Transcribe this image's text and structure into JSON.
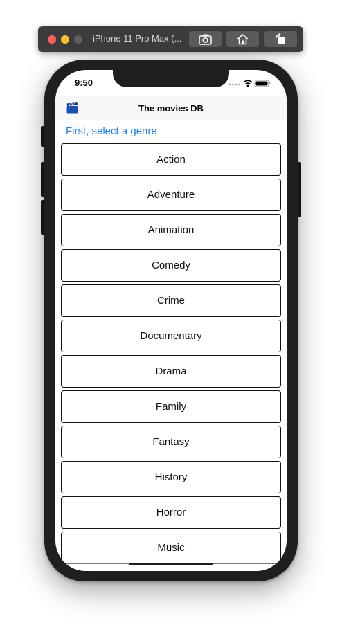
{
  "simulator": {
    "title": "iPhone 11 Pro Max (..."
  },
  "status_bar": {
    "time": "9:50"
  },
  "navbar": {
    "title": "The movies DB"
  },
  "prompt": "First, select a genre",
  "genres": [
    "Action",
    "Adventure",
    "Animation",
    "Comedy",
    "Crime",
    "Documentary",
    "Drama",
    "Family",
    "Fantasy",
    "History",
    "Horror",
    "Music"
  ],
  "colors": {
    "link": "#1a7ff5",
    "navbar_bg": "#f7f7f7",
    "border": "#111111"
  }
}
